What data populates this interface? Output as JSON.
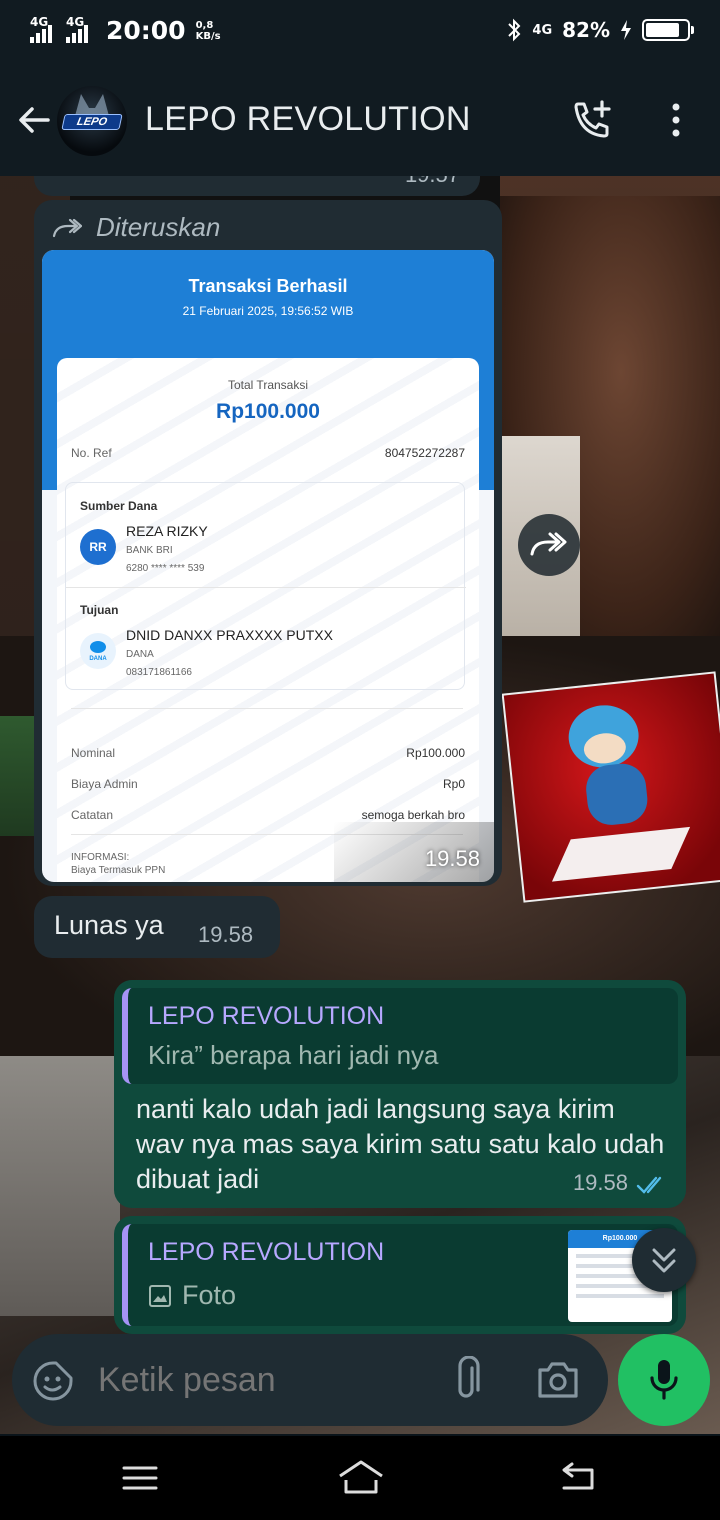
{
  "status_bar": {
    "sim1": "4G",
    "sim2": "4G",
    "time": "20:00",
    "speed_value": "0,8",
    "speed_unit": "KB/s",
    "net_right": "4G",
    "battery_pct": "82%",
    "battery_level": 0.82
  },
  "header": {
    "title": "LEPO REVOLUTION",
    "avatar_text": "LEPO"
  },
  "messages": {
    "previous_time": "19.57",
    "forwarded": {
      "label": "Diteruskan",
      "time": "19.58",
      "receipt": {
        "title": "Transaksi Berhasil",
        "date": "21 Februari 2025, 19:56:52 WIB",
        "total_label": "Total Transaksi",
        "total_amount": "Rp100.000",
        "ref_label": "No. Ref",
        "ref_value": "804752272287",
        "source_label": "Sumber Dana",
        "source_initials": "RR",
        "source_name": "REZA RIZKY",
        "source_bank": "BANK BRI",
        "source_account": "6280 **** **** 539",
        "dest_label": "Tujuan",
        "dest_icon_text": "DANA",
        "dest_name": "DNID DANXX PRAXXXX PUTXX",
        "dest_bank": "DANA",
        "dest_account": "083171861166",
        "rows": [
          {
            "label": "Nominal",
            "value": "Rp100.000"
          },
          {
            "label": "Biaya Admin",
            "value": "Rp0"
          },
          {
            "label": "Catatan",
            "value": "semoga berkah bro"
          }
        ],
        "info_label": "INFORMASI:",
        "info_text": "Biaya Termasuk PPN"
      }
    },
    "lunas": {
      "text": "Lunas ya",
      "time": "19.58"
    },
    "reply": {
      "quote_name": "LEPO REVOLUTION",
      "quote_text": "Kira” berapa hari jadi nya",
      "text": "nanti kalo udah jadi langsung saya kirim wav nya mas saya kirim satu satu kalo udah dibuat jadi",
      "time": "19.58",
      "status": "read"
    },
    "reply2": {
      "quote_name": "LEPO REVOLUTION",
      "quote_text": "Foto",
      "thumb_text": "Rp100.000"
    }
  },
  "composer": {
    "placeholder": "Ketik pesan"
  },
  "colors": {
    "accent_green": "#21c063",
    "quote_bar": "#a693f5",
    "read_ticks": "#53bdeb"
  }
}
